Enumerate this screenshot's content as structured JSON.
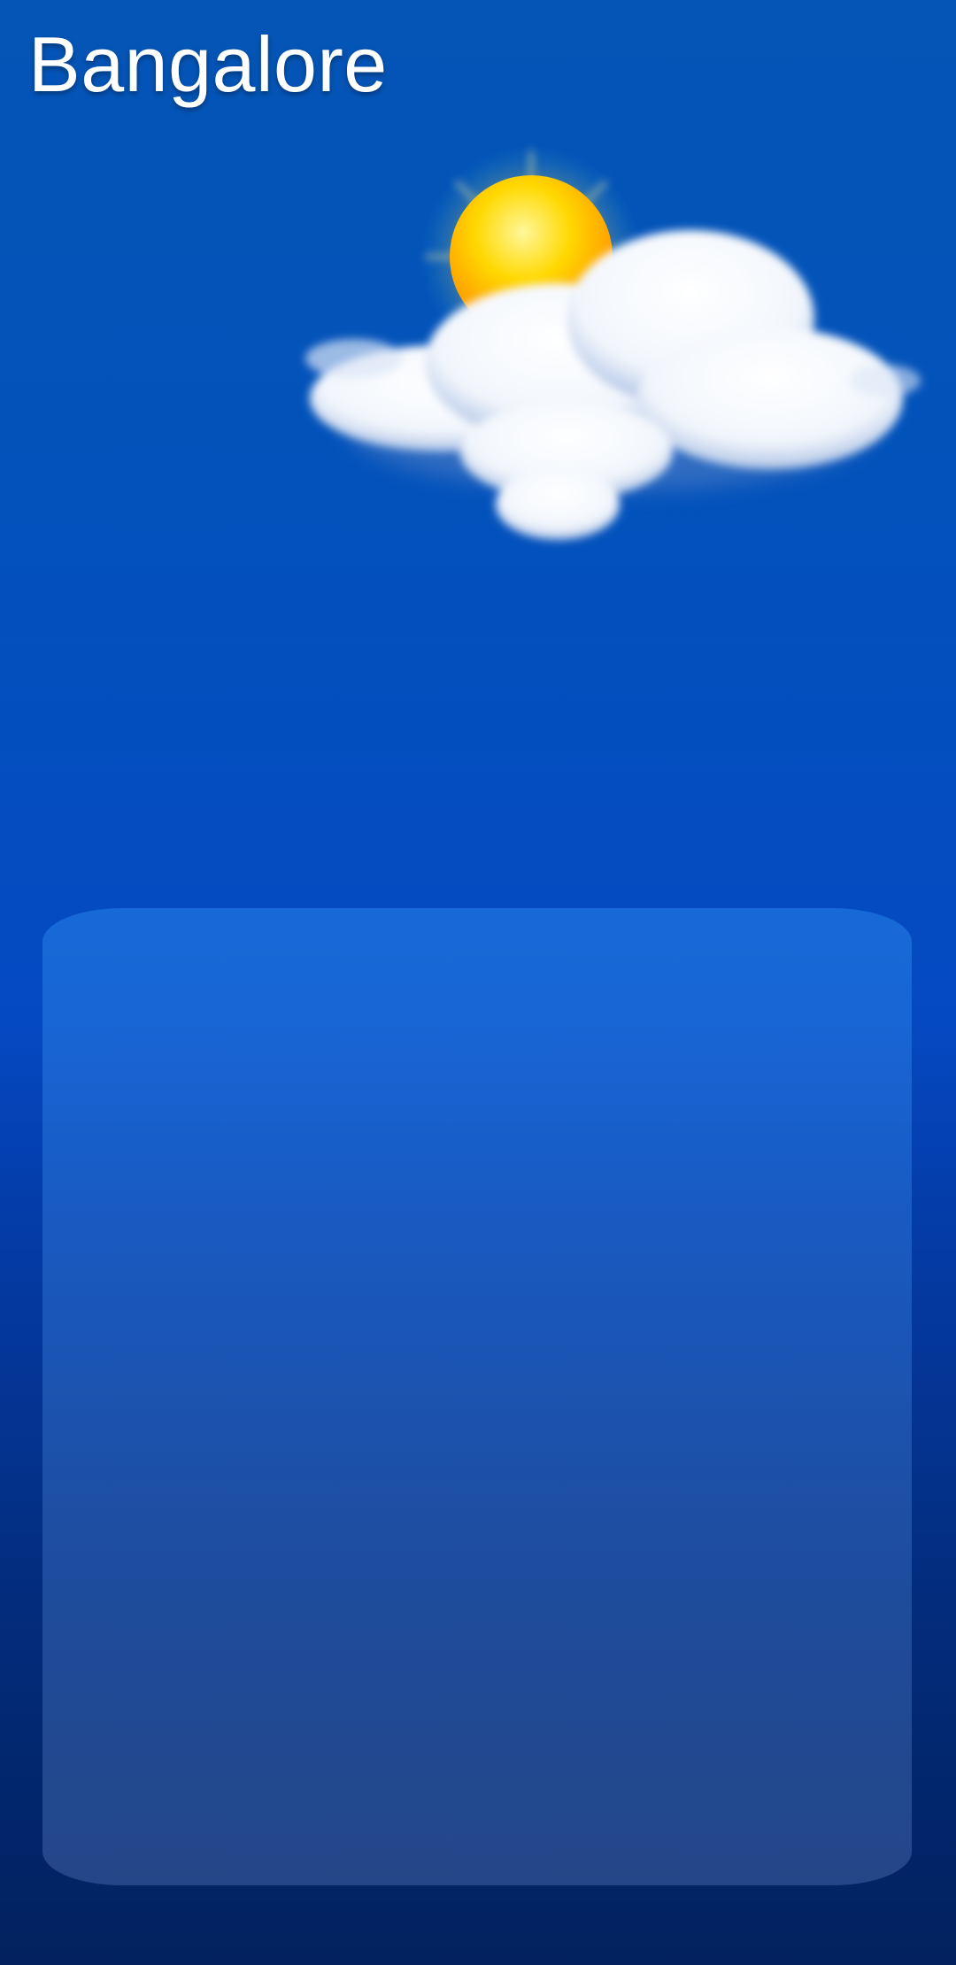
{
  "header": {
    "city": "Bangalore"
  },
  "weather": {
    "condition_icon": "partly-cloudy-icon"
  },
  "forecast_card": {
    "content": ""
  },
  "colors": {
    "sky_top": "#0455b6",
    "sky_mid": "#0549c2",
    "sky_bottom": "#02215e",
    "sun": "#ffd400",
    "cloud": "#ffffff"
  }
}
